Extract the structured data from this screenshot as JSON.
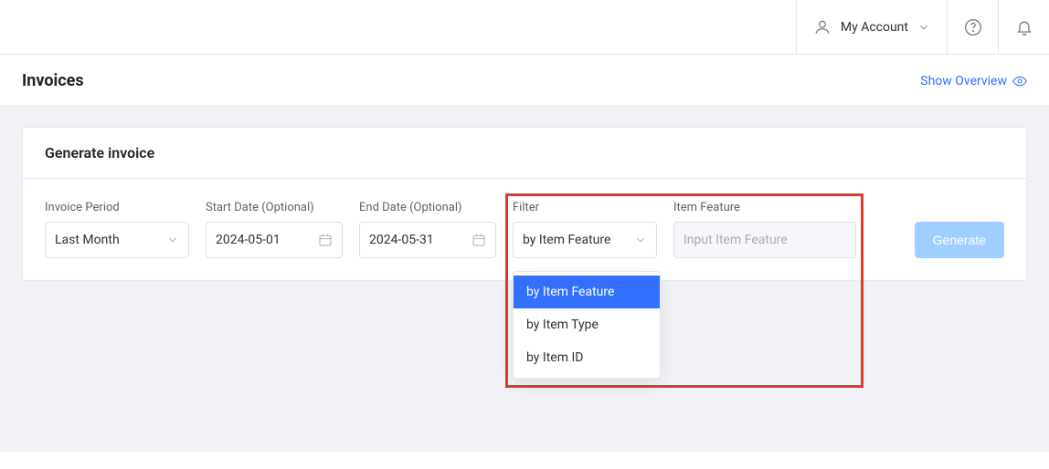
{
  "header": {
    "account_label": "My Account"
  },
  "page": {
    "title": "Invoices",
    "show_overview_label": "Show Overview"
  },
  "card": {
    "title": "Generate invoice",
    "period": {
      "label": "Invoice Period",
      "value": "Last Month"
    },
    "start": {
      "label": "Start Date (Optional)",
      "value": "2024-05-01"
    },
    "end": {
      "label": "End Date (Optional)",
      "value": "2024-05-31"
    },
    "filter": {
      "label": "Filter",
      "value": "by Item Feature"
    },
    "feature": {
      "label": "Item Feature",
      "placeholder": "Input Item Feature"
    },
    "generate_label": "Generate"
  },
  "dropdown": {
    "options": [
      "by Item Feature",
      "by Item Type",
      "by Item ID"
    ],
    "selected_index": 0
  }
}
